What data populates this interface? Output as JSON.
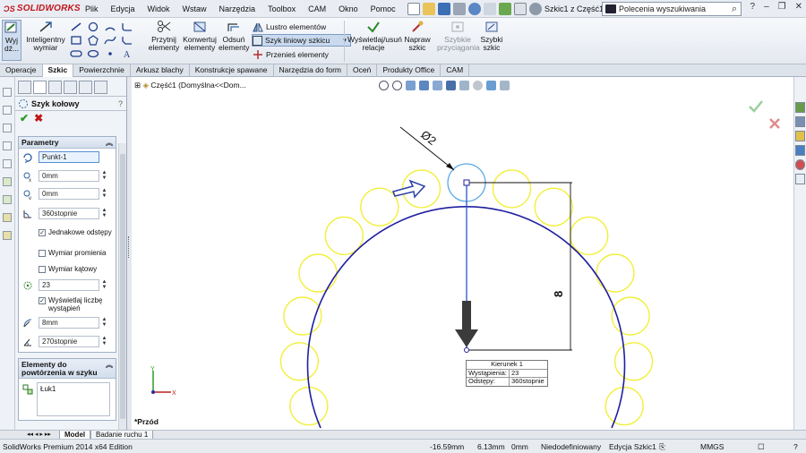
{
  "app": {
    "brand": "SOLIDWORKS",
    "document_title": "Szkic1 z Część1 *"
  },
  "menu": [
    "Plik",
    "Edycja",
    "Widok",
    "Wstaw",
    "Narzędzia",
    "Toolbox",
    "CAM",
    "Okno",
    "Pomoc"
  ],
  "search": {
    "placeholder": "Polecenia wyszukiwania"
  },
  "command_manager": {
    "exit_sketch": "Wyj dź...",
    "smart_dim": "Inteligentny wymiar",
    "trim": "Przytnij elementy",
    "convert": "Konwertuj elementy",
    "offset": "Odsuń elementy",
    "mirror": "Lustro elementów",
    "linear_pattern": "Szyk liniowy szkicu",
    "move": "Przenieś elementy",
    "relations": "Wyświetlaj/usuń relacje",
    "repair": "Napraw szkic",
    "quick_snaps": "Szybkie przyciągania",
    "rapid_sketch": "Szybki szkic"
  },
  "tabs": [
    "Operacje",
    "Szkic",
    "Powierzchnie",
    "Arkusz blachy",
    "Konstrukcje spawane",
    "Narzędzia do form",
    "Oceń",
    "Produkty Office",
    "CAM"
  ],
  "property_manager": {
    "title": "Szyk kołowy",
    "help": "?",
    "params_group": "Parametry",
    "center_point": "Punkt-1",
    "x_coord": "0mm",
    "y_coord": "0mm",
    "angle": "360stopnie",
    "equal_spacing": "Jednakowe odstępy",
    "radius_dim": "Wymiar promienia",
    "angle_dim": "Wymiar kątowy",
    "instances": "23",
    "show_count": "Wyświetlaj liczbę wystąpień",
    "radius": "8mm",
    "arc_angle": "270stopnie",
    "entities_group": "Elementy do powtórzenia w szyku",
    "entity_item": "Łuk1"
  },
  "canvas": {
    "breadcrumb": "Część1 (Domyślna<<Dom...",
    "view": "*Przód",
    "dimension_diameter": "Ø2",
    "dimension_radius": "8",
    "tag": {
      "title": "Kierunek 1",
      "instances_label": "Wystąpienia:",
      "instances_value": "23",
      "spacing_label": "Odstępy:",
      "spacing_value": "360stopnie"
    }
  },
  "bottom_tabs": [
    "Model",
    "Badanie ruchu 1"
  ],
  "status": {
    "edition": "SolidWorks Premium 2014 x64 Edition",
    "x": "-16.59mm",
    "y": "6.13mm",
    "z": "0mm",
    "state": "Niedodefiniowany",
    "mode": "Edycja Szkic1",
    "units": "MMGS"
  },
  "colors": {
    "pattern_yellow": "#f2ef3a",
    "arc_blue": "#1f1fa0",
    "selected_blue": "#5aa8e6",
    "brand_red": "#c0161c"
  }
}
